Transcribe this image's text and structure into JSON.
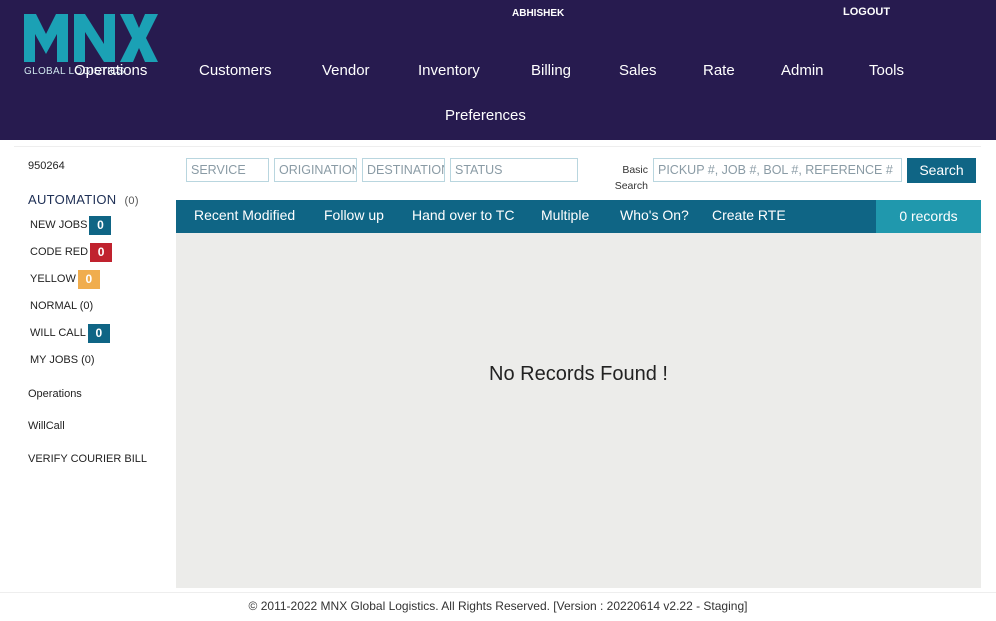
{
  "header": {
    "logo_text": "MNX",
    "logo_subtitle": "GLOBAL LOGISTICS",
    "user": "ABHISHEK",
    "logout": "LOGOUT",
    "nav": [
      "Operations",
      "Customers",
      "Vendor",
      "Inventory",
      "Billing",
      "Sales",
      "Rate",
      "Admin",
      "Tools",
      "Preferences"
    ]
  },
  "sidebar": {
    "id": "950264",
    "automation_label": "AUTOMATION",
    "automation_count": "(0)",
    "items": [
      {
        "label": "NEW JOBS",
        "badge": "0",
        "badge_color": "#0f6585"
      },
      {
        "label": "CODE RED",
        "badge": "0",
        "badge_color": "#c0222e"
      },
      {
        "label": "YELLOW",
        "badge": "0",
        "badge_color": "#f0ad4e"
      },
      {
        "label": "NORMAL (0)"
      },
      {
        "label": "WILL CALL",
        "badge": "0",
        "badge_color": "#0f6585"
      },
      {
        "label": "MY JOBS (0)"
      }
    ],
    "links": [
      "Operations",
      "WillCall",
      "VERIFY COURIER BILL"
    ]
  },
  "filters": {
    "service_placeholder": "SERVICE",
    "origination_placeholder": "ORIGINATION",
    "destination_placeholder": "DESTINATION",
    "status_placeholder": "STATUS",
    "basic_search_label": "Basic Search",
    "search_placeholder": "PICKUP #, JOB #, BOL #, REFERENCE #",
    "search_button": "Search"
  },
  "tabs": [
    "Recent Modified",
    "Follow up",
    "Hand over to TC",
    "Multiple",
    "Who's On?",
    "Create RTE"
  ],
  "records_count": "0 records",
  "empty_message": "No Records Found !",
  "footer": "© 2011-2022 MNX Global Logistics. All Rights Reserved. [Version : 20220614 v2.22 - Staging]",
  "colors": {
    "header_bg": "#271b4f",
    "logo_teal": "#1ba1b5",
    "primary_blue": "#0f6585",
    "records_teal": "#2098ad",
    "content_bg": "#ececea"
  }
}
